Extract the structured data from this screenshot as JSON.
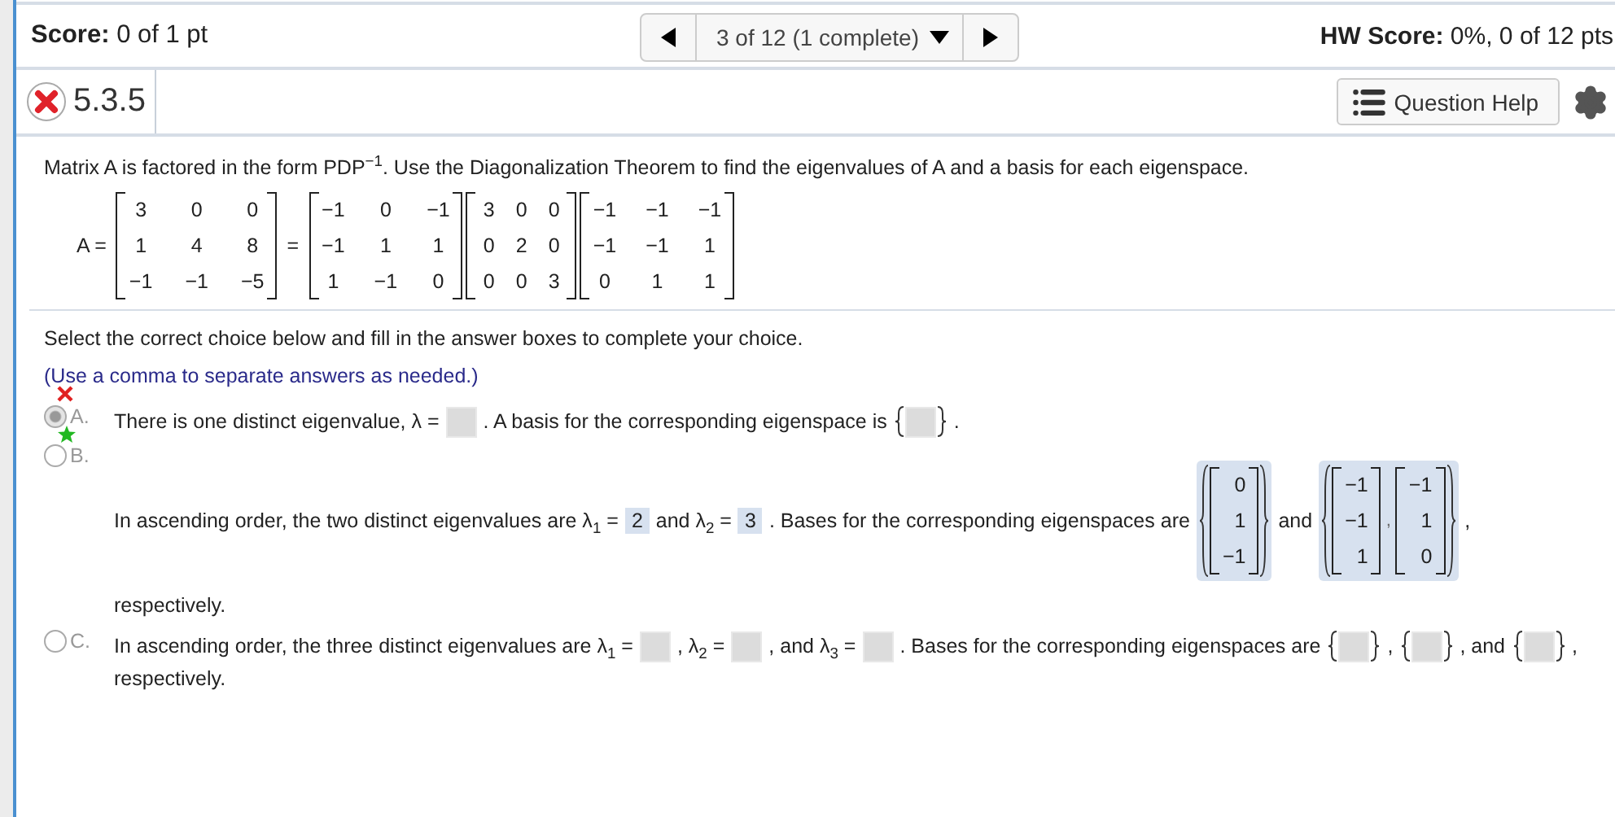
{
  "header": {
    "score_label": "Score:",
    "score_value": "0 of 1 pt",
    "nav_text": "3 of 12 (1 complete)",
    "hw_label": "HW Score:",
    "hw_value": "0%, 0 of 12 pts"
  },
  "question": {
    "number": "5.3.5",
    "correct": false,
    "help_button": "Question Help"
  },
  "prompt": "Matrix A is factored in the form PDP$^{−1}$. Use the Diagonalization Theorem to find the eigenvalues of A and a basis for each eigenspace.",
  "equation": {
    "lhs": "A =",
    "equals": "=",
    "matrices": [
      [
        [
          "3",
          "0",
          "0"
        ],
        [
          "1",
          "4",
          "8"
        ],
        [
          "−1",
          "−1",
          "−5"
        ]
      ],
      [
        [
          "−1",
          "0",
          "−1"
        ],
        [
          "−1",
          "1",
          "1"
        ],
        [
          "1",
          "−1",
          "0"
        ]
      ],
      [
        [
          "3",
          "0",
          "0"
        ],
        [
          "0",
          "2",
          "0"
        ],
        [
          "0",
          "0",
          "3"
        ]
      ],
      [
        [
          "−1",
          "−1",
          "−1"
        ],
        [
          "−1",
          "−1",
          "1"
        ],
        [
          "0",
          "1",
          "1"
        ]
      ]
    ]
  },
  "instructions": "Select the correct choice below and fill in the answer boxes to complete your choice.",
  "note": "(Use a comma to separate answers as needed.)",
  "choices": [
    {
      "letter": "A.",
      "selected": true,
      "marked_wrong": true,
      "marked_right": false,
      "lines": [
        [
          {
            "kind": "text",
            "text": "There is one distinct eigenvalue, λ ="
          },
          {
            "kind": "blank"
          },
          {
            "kind": "text",
            "text": ". A basis for the corresponding eigenspace is"
          },
          {
            "kind": "set_blank"
          },
          {
            "kind": "text",
            "text": "."
          }
        ]
      ]
    },
    {
      "letter": "B.",
      "selected": false,
      "marked_wrong": false,
      "marked_right": true,
      "lines": [
        [
          {
            "kind": "text",
            "text": "In ascending order, the two distinct eigenvalues are λ$_{1}$ ="
          },
          {
            "kind": "answer",
            "value": "2"
          },
          {
            "kind": "text",
            "text": "and λ$_{2}$ ="
          },
          {
            "kind": "answer",
            "value": "3"
          },
          {
            "kind": "text",
            "text": ". Bases for the corresponding eigenspaces are"
          },
          {
            "kind": "vector_set",
            "vectors": [
              [
                "0",
                "1",
                "−1"
              ]
            ]
          },
          {
            "kind": "text",
            "text": "and"
          },
          {
            "kind": "vector_set",
            "separator": ",",
            "vectors": [
              [
                "−1",
                "−1",
                "1"
              ],
              [
                "−1",
                "1",
                "0"
              ]
            ]
          },
          {
            "kind": "text",
            "text": ","
          }
        ],
        [
          {
            "kind": "text",
            "text": "respectively."
          }
        ]
      ]
    },
    {
      "letter": "C.",
      "selected": false,
      "marked_wrong": false,
      "marked_right": false,
      "lines": [
        [
          {
            "kind": "text",
            "text": "In ascending order, the three distinct eigenvalues are λ$_{1}$ ="
          },
          {
            "kind": "blank"
          },
          {
            "kind": "text",
            "text": ", λ$_{2}$ ="
          },
          {
            "kind": "blank"
          },
          {
            "kind": "text",
            "text": ", and λ$_{3}$ ="
          },
          {
            "kind": "blank"
          },
          {
            "kind": "text",
            "text": ". Bases for the corresponding eigenspaces are"
          },
          {
            "kind": "set_blank"
          },
          {
            "kind": "text",
            "text": ","
          },
          {
            "kind": "set_blank"
          },
          {
            "kind": "text",
            "text": ", and"
          },
          {
            "kind": "set_blank"
          },
          {
            "kind": "text",
            "text": ","
          }
        ],
        [
          {
            "kind": "text",
            "text": "respectively."
          }
        ]
      ]
    }
  ]
}
